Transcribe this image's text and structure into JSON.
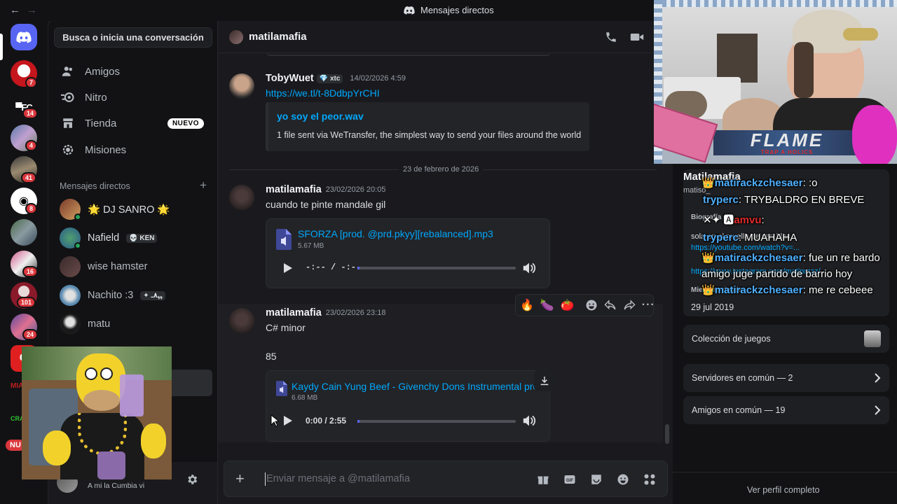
{
  "window": {
    "title": "Mensajes directos",
    "back": "←",
    "forward": "→"
  },
  "servers": [
    {
      "name": "discord-home",
      "badge": ""
    },
    {
      "name": "server-men",
      "badge": "7"
    },
    {
      "name": "server-fc",
      "badge": "14"
    },
    {
      "name": "server-3",
      "badge": "4"
    },
    {
      "name": "server-4",
      "badge": "41"
    },
    {
      "name": "server-5",
      "badge": "8"
    },
    {
      "name": "server-6",
      "badge": ""
    },
    {
      "name": "server-7",
      "badge": "16"
    },
    {
      "name": "server-8",
      "badge": "101"
    },
    {
      "name": "server-9",
      "badge": "24"
    },
    {
      "name": "server-10",
      "badge": ""
    },
    {
      "name": "server-11",
      "badge": ""
    }
  ],
  "rail_nuevo": "NU",
  "dm_sidebar": {
    "search": "Busca o inicia una conversación",
    "nav": [
      {
        "label": "Amigos",
        "icon": "friends-icon"
      },
      {
        "label": "Nitro",
        "icon": "nitro-icon"
      },
      {
        "label": "Tienda",
        "icon": "shop-icon",
        "badge": "NUEVO"
      },
      {
        "label": "Misiones",
        "icon": "quests-icon"
      }
    ],
    "section_title": "Mensajes directos",
    "add": "+",
    "dms": [
      {
        "name": "🌟 DJ SANRO 🌟",
        "tag": ""
      },
      {
        "name": "Nafield",
        "tag": "💀 KEN"
      },
      {
        "name": "wise hamster",
        "tag": ""
      },
      {
        "name": "Nachito :3",
        "tag": "✦ ﮩﮩ٨ـ"
      },
      {
        "name": "matu",
        "tag": ""
      }
    ],
    "user_status": "A mi la Cumbia vi"
  },
  "chat": {
    "recipient": "matilamafia",
    "messages": [
      {
        "author": "TobyWuet",
        "tag": "💎 xtc",
        "time": "14/02/2026 4:59",
        "link": "https://we.tl/t-8DdbpYrCHI",
        "embed": {
          "title": "yo soy el peor.wav",
          "desc": "1 file sent via WeTransfer, the simplest way to send your files around the world"
        }
      },
      {
        "divider": "23 de febrero de 2026"
      },
      {
        "author": "matilamafia",
        "time": "23/02/2026 20:05",
        "text": "cuando te pinte mandale gil",
        "attachment": {
          "name": "SFORZA [prod. @prd.pkyy][rebalanced].mp3",
          "size": "5.67 MB",
          "time": "-:-- / -:--"
        }
      },
      {
        "author": "matilamafia",
        "time": "23/02/2026 23:18",
        "text": "C# minor",
        "text2": "85",
        "attachment": {
          "name": "Kaydy Cain Yung Beef - Givenchy Dons Instrumental pro",
          "size": "6.68 MB",
          "time": "0:00 / 2:55"
        }
      }
    ],
    "reactions": [
      "🔥",
      "🍆",
      "🍅"
    ],
    "composer_placeholder": "Enviar mensaje a @matilamafia"
  },
  "profile": {
    "display_name": "Matilamafia",
    "username": "matiso_",
    "bio_title": "Biografía",
    "bio": "sola en el muelle de san blas",
    "bio_link1": "https://youtube.com/watch?v=...",
    "bio_link2": "https://www.instagram.com/matiprzzz/",
    "member_since_label": "Miembro desde",
    "member_since": "29 jul 2019",
    "games": "Colección de juegos",
    "servers_common": "Servidores en común — 2",
    "friends_common": "Amigos en común — 19",
    "view_full": "Ver perfil completo"
  },
  "stream_chat": [
    {
      "user": "matirackzchesaer",
      "msg": ": :o"
    },
    {
      "user": "tryperc",
      "msg": ": TRYBALDRO EN BREVE"
    },
    {
      "user": "amvu",
      "msg": ":"
    },
    {
      "user": "tryperc",
      "msg": ": MUAHAHA"
    },
    {
      "user": "matirackzchesaer",
      "msg": ": fue un re bardo amigo juge partido de barrio hoy"
    },
    {
      "user": "matirackzchesaer",
      "msg": ": me re cebeee"
    }
  ],
  "stream_overlay": {
    "banner": "FLAME",
    "banner_sub": "TRAP A HOLICS"
  }
}
